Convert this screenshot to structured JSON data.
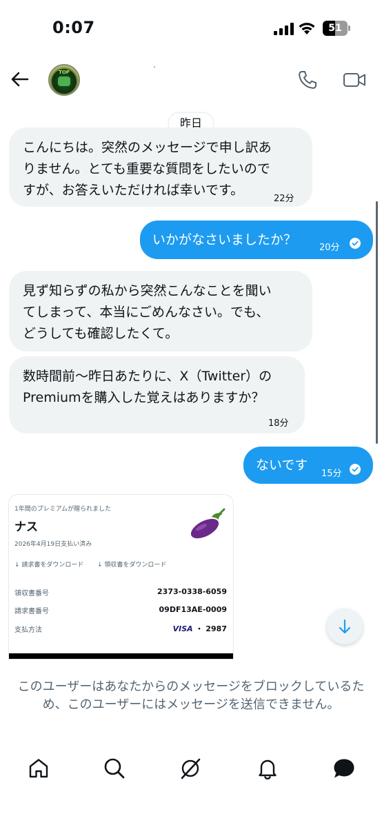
{
  "status_bar": {
    "time": "0:07",
    "battery": "51",
    "battery_level": 0.51
  },
  "header": {
    "contact_name": "`",
    "avatar_text": "TOP"
  },
  "conversation": {
    "date_divider": "昨日",
    "messages": [
      {
        "direction": "incoming",
        "lines": [
          "こんにちは。突然のメッセージで申し訳あ",
          "りません。とても重要な質問をしたいので",
          "すが、お答えいただければ幸いです。"
        ],
        "time": "22分"
      },
      {
        "direction": "outgoing",
        "lines": [
          "いかがなさいましたか？"
        ],
        "time": "20分",
        "read": true
      },
      {
        "direction": "incoming",
        "lines": [
          "見ず知らずの私から突然こんなことを聞い",
          "てしまって、本当にごめんなさい。でも、",
          "どうしても確認したくて。"
        ]
      },
      {
        "direction": "incoming",
        "lines": [
          "数時間前〜昨日あたりに、X（Twitter）の",
          "Premiumを購入した覚えはありますか？"
        ],
        "time": "18分"
      },
      {
        "direction": "outgoing",
        "lines": [
          "ないです"
        ],
        "time": "15分",
        "read": true
      }
    ]
  },
  "receipt": {
    "gift_text": "1年間のプレミアムが贈られました",
    "recipient": "ナス",
    "date_text": "2026年4月19日支払い済み",
    "download_invoice": "↓ 請求書をダウンロード",
    "download_receipt": "↓ 領収書をダウンロード",
    "rows": [
      {
        "label": "領収書番号",
        "value": "2373-0338-6059"
      },
      {
        "label": "請求書番号",
        "value": "09DF13AE-0009"
      },
      {
        "label": "支払方法",
        "value": "VISA ・ 2987"
      }
    ],
    "card_brand": "VISA",
    "card_last4": "・ 2987"
  },
  "blocked_notice": "このユーザーはあなたからのメッセージをブロックしているため、このユーザーにはメッセージを送信できません。",
  "nav": [
    "home-icon",
    "search-icon",
    "grok-icon",
    "notifications-icon",
    "messages-icon"
  ],
  "colors": {
    "accent": "#1d9bf0",
    "incoming_bubble": "#eff3f4",
    "text_secondary": "#536471"
  }
}
